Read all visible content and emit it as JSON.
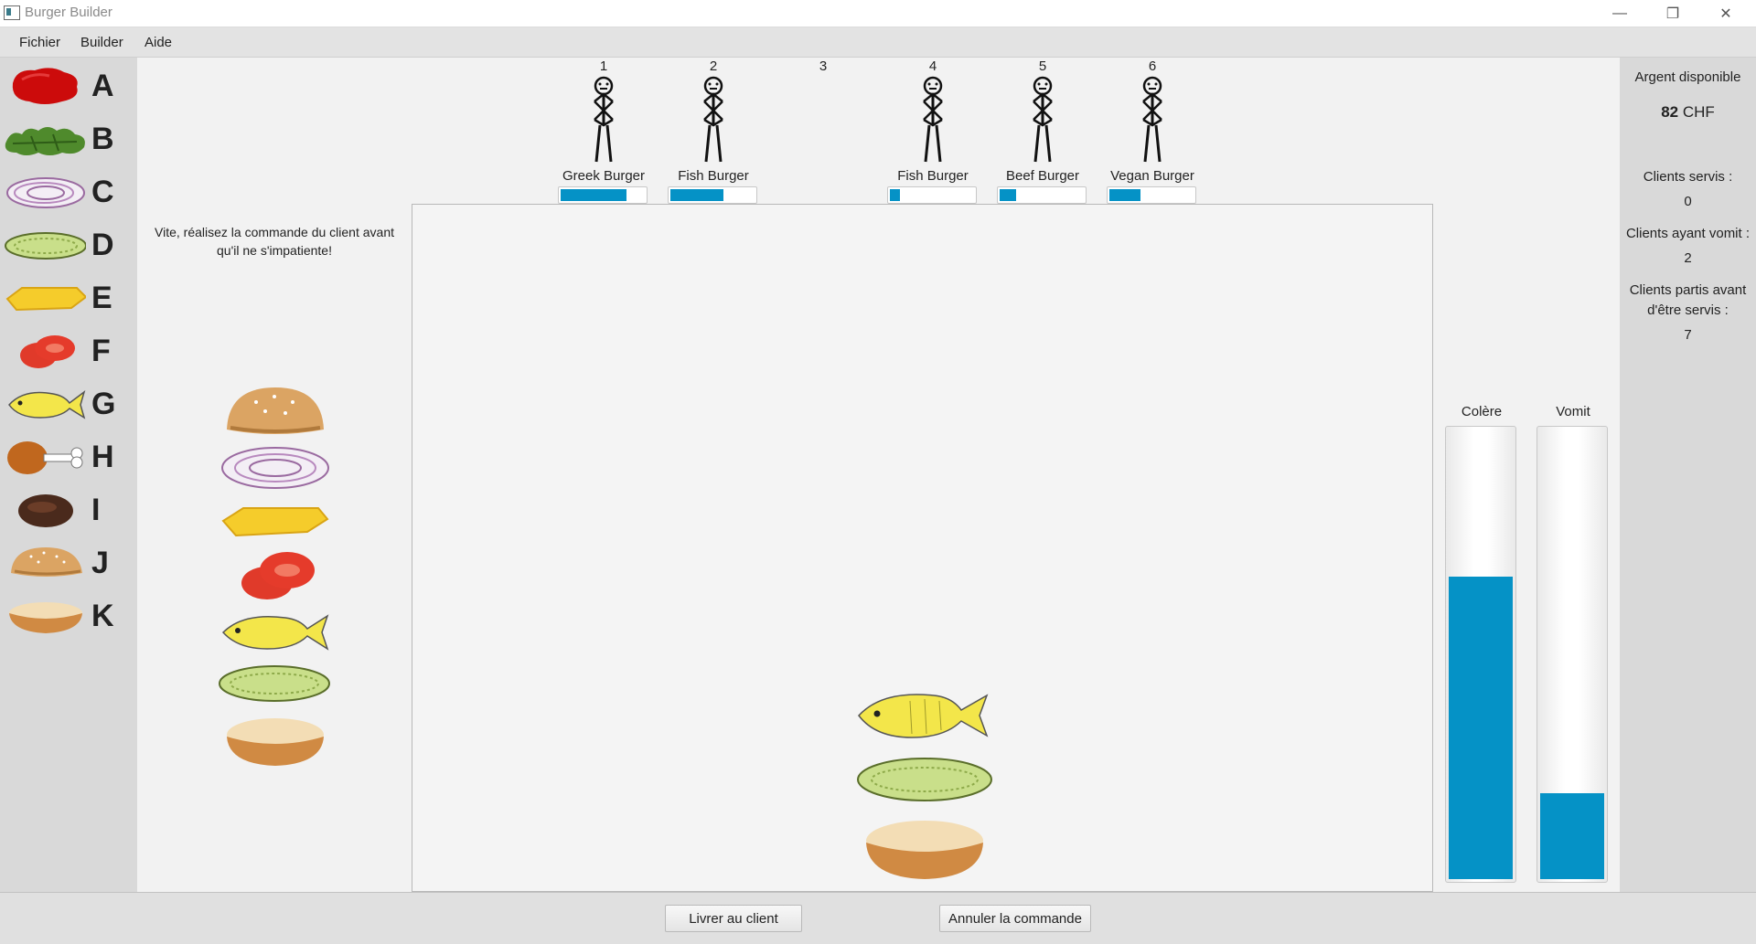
{
  "window": {
    "title": "Burger Builder",
    "controls": [
      "minimize",
      "restore",
      "close"
    ]
  },
  "menu": {
    "items": [
      "Fichier",
      "Builder",
      "Aide"
    ]
  },
  "ingredients": [
    {
      "letter": "A",
      "icon": "ketchup-icon"
    },
    {
      "letter": "B",
      "icon": "lettuce-icon"
    },
    {
      "letter": "C",
      "icon": "onion-rings-icon"
    },
    {
      "letter": "D",
      "icon": "pickle-icon"
    },
    {
      "letter": "E",
      "icon": "cheese-icon"
    },
    {
      "letter": "F",
      "icon": "tomato-icon"
    },
    {
      "letter": "G",
      "icon": "fish-icon"
    },
    {
      "letter": "H",
      "icon": "chicken-leg-icon"
    },
    {
      "letter": "I",
      "icon": "beef-patty-icon"
    },
    {
      "letter": "J",
      "icon": "bun-top-icon"
    },
    {
      "letter": "K",
      "icon": "bun-bottom-icon"
    }
  ],
  "instruction": "Vite, réalisez la commande du client avant qu'il ne s'impatiente!",
  "order_stack": [
    "bun-top-icon",
    "onion-rings-icon",
    "cheese-icon",
    "tomato-icon",
    "fish-icon",
    "pickle-icon",
    "bun-bottom-icon"
  ],
  "customers": [
    {
      "number": "1",
      "order": "Greek Burger",
      "patience": 0.78,
      "present": true
    },
    {
      "number": "2",
      "order": "Fish Burger",
      "patience": 0.63,
      "present": true
    },
    {
      "number": "3",
      "order": "",
      "patience": 0,
      "present": false
    },
    {
      "number": "4",
      "order": "Fish Burger",
      "patience": 0.12,
      "present": true
    },
    {
      "number": "5",
      "order": "Beef Burger",
      "patience": 0.2,
      "present": true
    },
    {
      "number": "6",
      "order": "Vegan Burger",
      "patience": 0.37,
      "present": true
    }
  ],
  "workspace_stack": [
    "fish-icon",
    "pickle-icon",
    "bun-bottom-icon"
  ],
  "gauges": [
    {
      "label": "Colère",
      "level": 0.67
    },
    {
      "label": "Vomit",
      "level": 0.19
    }
  ],
  "stats": {
    "money_label": "Argent disponible",
    "money_amount": "82",
    "money_currency": "CHF",
    "served_label": "Clients servis :",
    "served_value": "0",
    "vomited_label": "Clients ayant vomit :",
    "vomited_value": "2",
    "left_label": "Clients partis avant d'être servis :",
    "left_value": "7"
  },
  "buttons": {
    "deliver": "Livrer au client",
    "cancel": "Annuler la commande"
  },
  "colors": {
    "accent": "#0592c6",
    "panel": "#d9d9d9",
    "background": "#f2f2f2"
  }
}
